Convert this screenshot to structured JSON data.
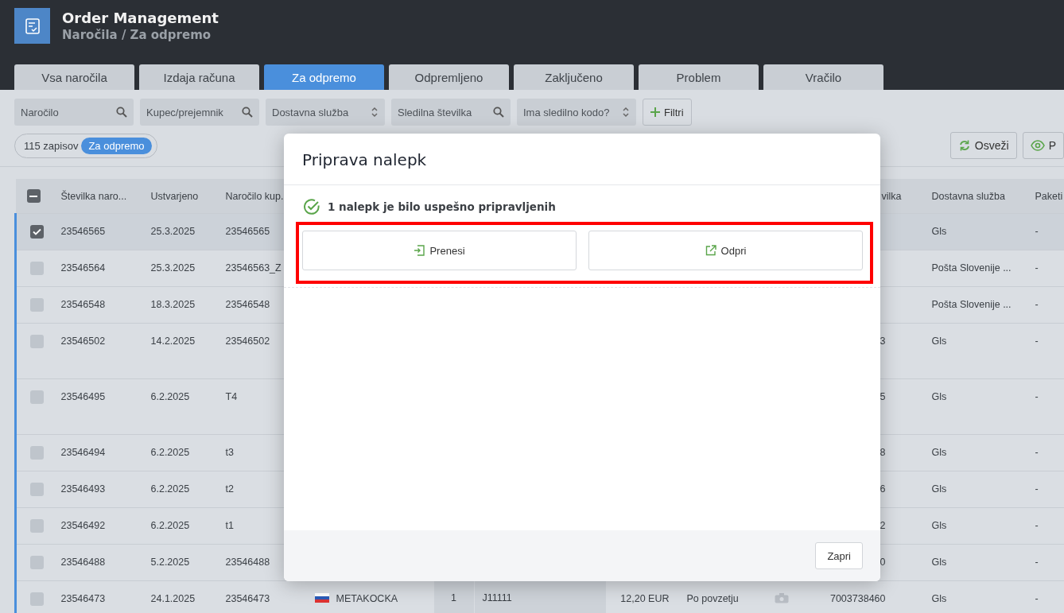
{
  "app": {
    "title": "Order Management",
    "breadcrumb": "Naročila / Za odpremo"
  },
  "tabs": [
    {
      "label": "Vsa naročila",
      "selected": false
    },
    {
      "label": "Izdaja računa",
      "selected": false
    },
    {
      "label": "Za odpremo",
      "selected": true
    },
    {
      "label": "Odpremljeno",
      "selected": false
    },
    {
      "label": "Zaključeno",
      "selected": false
    },
    {
      "label": "Problem",
      "selected": false
    },
    {
      "label": "Vračilo",
      "selected": false
    }
  ],
  "filters": [
    {
      "placeholder": "Naročilo",
      "kind": "search"
    },
    {
      "placeholder": "Kupec/prejemnik",
      "kind": "search"
    },
    {
      "placeholder": "Dostavna služba",
      "kind": "select"
    },
    {
      "placeholder": "Sledilna številka",
      "kind": "search"
    },
    {
      "placeholder": "Ima sledilno kodo?",
      "kind": "select"
    }
  ],
  "filter_button": "Filtri",
  "record_count": "115 zapisov",
  "status_badge": "Za odpremo",
  "actions": [
    {
      "label": "Osveži",
      "kind": "refresh"
    },
    {
      "label": "P",
      "kind": "view"
    }
  ],
  "table": {
    "select_all_indeterminate": true,
    "columns": [
      "Številka naro...",
      "Ustvarjeno",
      "Naročilo kup.",
      "vilka",
      "Dostavna služba",
      "Paketi"
    ],
    "rows": [
      {
        "selected": true,
        "tall": false,
        "number": "23546565",
        "created": "25.3.2025",
        "customer_order": "23546565",
        "delivery": "Gls",
        "packages": "-"
      },
      {
        "selected": false,
        "tall": false,
        "number": "23546564",
        "created": "25.3.2025",
        "customer_order": "23546563_Z",
        "delivery": "Pošta Slovenije ...",
        "packages": "-"
      },
      {
        "selected": false,
        "tall": false,
        "number": "23546548",
        "created": "18.3.2025",
        "customer_order": "23546548",
        "delivery": "Pošta Slovenije ...",
        "packages": "-"
      },
      {
        "selected": false,
        "tall": true,
        "number": "23546502",
        "created": "14.2.2025",
        "customer_order": "23546502",
        "tracking": "3",
        "delivery": "Gls",
        "packages": "-"
      },
      {
        "selected": false,
        "tall": true,
        "number": "23546495",
        "created": "6.2.2025",
        "customer_order": "T4",
        "tracking": "5",
        "delivery": "Gls",
        "packages": "-"
      },
      {
        "selected": false,
        "tall": false,
        "number": "23546494",
        "created": "6.2.2025",
        "customer_order": "t3",
        "tracking": "8",
        "delivery": "Gls",
        "packages": "-"
      },
      {
        "selected": false,
        "tall": false,
        "number": "23546493",
        "created": "6.2.2025",
        "customer_order": "t2",
        "tracking": "6",
        "delivery": "Gls",
        "packages": "-"
      },
      {
        "selected": false,
        "tall": false,
        "number": "23546492",
        "created": "6.2.2025",
        "customer_order": "t1",
        "tracking": "2",
        "delivery": "Gls",
        "packages": "-"
      },
      {
        "selected": false,
        "tall": false,
        "number": "23546488",
        "created": "5.2.2025",
        "customer_order": "23546488",
        "tracking": "0",
        "delivery": "Gls",
        "packages": "-"
      },
      {
        "selected": false,
        "tall": false,
        "number": "23546473",
        "created": "24.1.2025",
        "customer_order": "23546473",
        "customer": "METAKOCKA",
        "quantity": "1",
        "reference": "J11111",
        "amount": "12,20 EUR",
        "payment": "Po povzetju",
        "tracking": "7003738460",
        "delivery": "Gls",
        "packages": "-"
      }
    ]
  },
  "modal": {
    "title": "Priprava nalepk",
    "message": "1 nalepk je bilo uspešno pripravljenih",
    "highlighted": true,
    "buttons": [
      {
        "label": "Prenesi",
        "kind": "download"
      },
      {
        "label": "Odpri",
        "kind": "open"
      }
    ],
    "close": "Zapri"
  }
}
